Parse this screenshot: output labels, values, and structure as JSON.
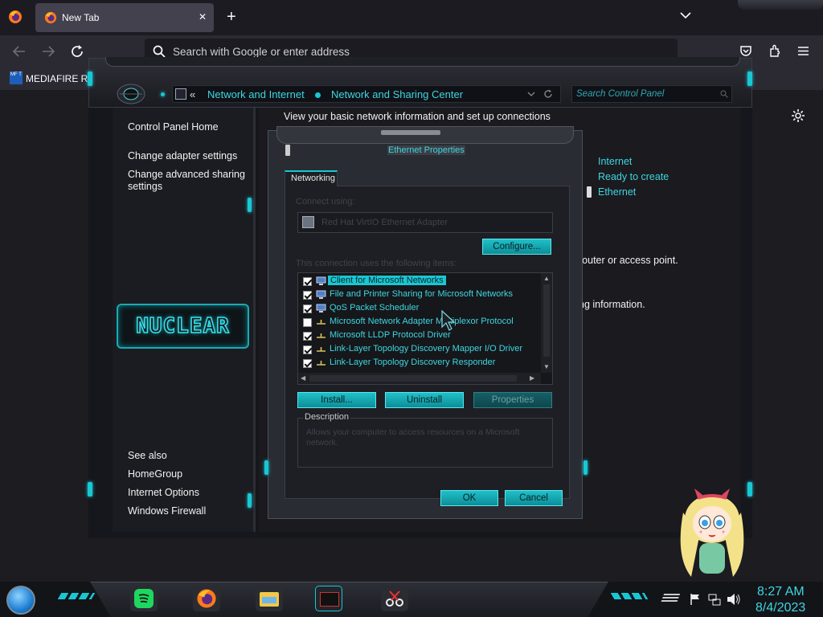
{
  "browser": {
    "tab_title": "New Tab",
    "new_tab_symbol": "+",
    "close_symbol": "✕",
    "address_placeholder": "Search with Google or enter address",
    "bookmark_label": "MEDIAFIRE RO",
    "bookmark_icon_text": "MF T"
  },
  "control_panel": {
    "breadcrumb_sep": "«",
    "breadcrumb": [
      "Network and Internet",
      "Network and Sharing Center"
    ],
    "search_placeholder": "Search Control Panel",
    "sidebar": {
      "top_links": [
        "Control Panel Home",
        "Change adapter settings",
        "Change advanced sharing settings"
      ],
      "logo_text": "NUCLEAR",
      "see_also_heading": "See also",
      "see_also_links": [
        "HomeGroup",
        "Internet Options",
        "Windows Firewall"
      ]
    },
    "main": {
      "heading": "View your basic network information and set up connections",
      "status_lines": [
        "Internet",
        "Ready to create",
        "Ethernet"
      ],
      "partial_text_1": "router or access point.",
      "partial_text_2": "ng information."
    }
  },
  "dialog": {
    "title": "Ethernet Properties",
    "tab_label": "Networking",
    "connect_using_label": "Connect using:",
    "adapter_name": "Red Hat VirtIO Ethernet Adapter",
    "configure_label": "Configure...",
    "items_label": "This connection uses the following items:",
    "items": [
      {
        "label": "Client for Microsoft Networks",
        "checked": true,
        "selected": true,
        "icon": "network-client-icon"
      },
      {
        "label": "File and Printer Sharing for Microsoft Networks",
        "checked": true,
        "selected": false,
        "icon": "network-client-icon"
      },
      {
        "label": "QoS Packet Scheduler",
        "checked": true,
        "selected": false,
        "icon": "network-client-icon"
      },
      {
        "label": "Microsoft Network Adapter Multiplexor Protocol",
        "checked": false,
        "selected": false,
        "icon": "protocol-icon"
      },
      {
        "label": "Microsoft LLDP Protocol Driver",
        "checked": true,
        "selected": false,
        "icon": "protocol-icon"
      },
      {
        "label": "Link-Layer Topology Discovery Mapper I/O Driver",
        "checked": true,
        "selected": false,
        "icon": "protocol-icon"
      },
      {
        "label": "Link-Layer Topology Discovery Responder",
        "checked": true,
        "selected": false,
        "icon": "protocol-icon"
      }
    ],
    "install_label": "Install...",
    "uninstall_label": "Uninstall",
    "properties_label": "Properties",
    "description_heading": "Description",
    "description_text": "Allows your computer to access resources on a Microsoft network.",
    "ok_label": "OK",
    "cancel_label": "Cancel"
  },
  "taskbar": {
    "time": "8:27 AM",
    "date": "8/4/2023"
  },
  "colors": {
    "accent": "#19c7d3",
    "text_teal": "#3ed6e0"
  }
}
